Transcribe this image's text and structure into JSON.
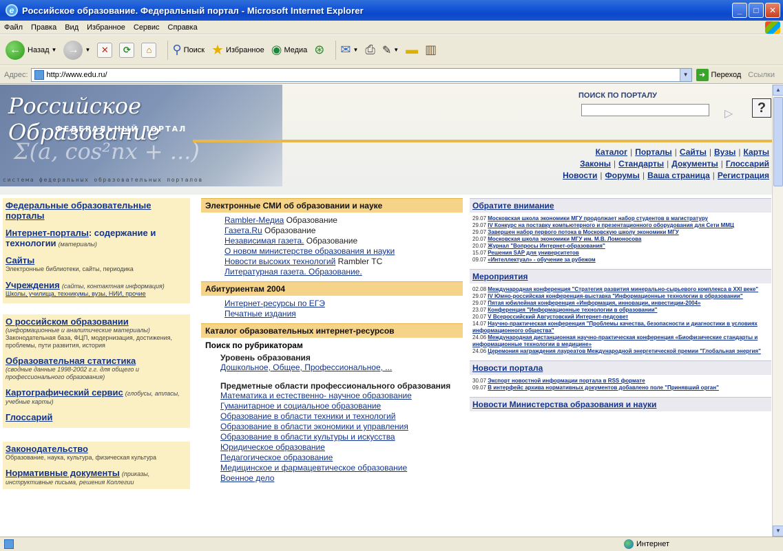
{
  "window": {
    "title": "Российское образование. Федеральный портал - Microsoft Internet Explorer"
  },
  "menu": [
    "Файл",
    "Правка",
    "Вид",
    "Избранное",
    "Сервис",
    "Справка"
  ],
  "toolbar": {
    "back": "Назад",
    "search": "Поиск",
    "favorites": "Избранное",
    "media": "Медиа"
  },
  "address": {
    "label": "Адрес:",
    "url": "http://www.edu.ru/",
    "go": "Переход",
    "links": "Ссылки"
  },
  "header": {
    "logo_title": "Российское Образование",
    "logo_sub": "ФЕДЕРАЛЬНЫЙ ПОРТАЛ",
    "formula": "Σ(a, cos²nx + ...)",
    "tagline": "система федеральных образовательных порталов",
    "search_title": "ПОИСК ПО ПОРТАЛУ",
    "help": "?"
  },
  "topnav": {
    "row1": [
      "Каталог",
      "Порталы",
      "Сайты",
      "Вузы",
      "Карты"
    ],
    "row2": [
      "Законы",
      "Стандарты",
      "Документы",
      "Глоссарий"
    ],
    "row3": [
      "Новости",
      "Форумы",
      "Ваша страница",
      "Регистрация"
    ]
  },
  "left": {
    "fed_portals": "Федеральные образовательные порталы",
    "inet_portals": "Интернет-порталы",
    "inet_portals_tail": ": содержание и технологии",
    "inet_portals_sub": "(материалы)",
    "sites": "Сайты",
    "sites_desc": "Электронные библиотеки, сайты, периодика",
    "institutions": "Учреждения",
    "institutions_sub": "(сайты, контактная информация)",
    "institutions_links": "Школы, училища, техникумы, вузы, НИИ, прочие",
    "ru_edu": "О российском образовании",
    "ru_edu_sub": "(информационные и аналитические материалы)",
    "ru_edu_desc": "Законодательная база, ФЦП, модернизация, достижения, проблемы, пути развития, история",
    "stats": "Образовательная статистика",
    "stats_sub": "(сводные данные 1998-2002 г.г. для общего и профессионального образования)",
    "cartography": "Картографический сервис",
    "cartography_sub": "(глобусы, атласы, учебные карты)",
    "glossary": "Глоссарий",
    "legislation": "Законодательство",
    "legislation_desc": "Образование, наука, культура, физическая культура",
    "normative": "Нормативные документы",
    "normative_sub": "(приказы, инструктивные письма, решения Коллегии"
  },
  "mid": {
    "smi_head": "Электронные СМИ об образовании и науке",
    "smi": [
      {
        "link": "Rambler-Медиа",
        "tail": " Образование"
      },
      {
        "link": "Газета.Ru",
        "tail": " Образование"
      },
      {
        "link": "Независимая газета.",
        "tail": " Образование"
      },
      {
        "link": "О новом министерстве образования и науки",
        "tail": ""
      },
      {
        "link": "Новости высоких технологий",
        "tail": " Rambler ТС"
      },
      {
        "link": "Литературная газета. Образование.",
        "tail": ""
      }
    ],
    "abit_head": "Абитуриентам 2004",
    "abit": [
      "Интернет-ресурсы по ЕГЭ",
      "Печатные издания"
    ],
    "catalog_head": "Каталог образовательных интернет-ресурсов",
    "rubricators": "Поиск по рубрикаторам",
    "level_head": "Уровень образования",
    "level_links": "Дошкольное, Общее, Профессиональное, ...",
    "subject_head": "Предметные области профессионального образования",
    "subjects": [
      "Математика и естественно- научное образование",
      "Гуманитарное и социальное образование",
      "Образование в области техники и технологий",
      "Образование в области экономики и управления",
      "Образование в области культуры и искусства",
      "Юридическое образование",
      "Педагогическое образование",
      "Медицинское и фармацевтическое образование",
      "Военное дело"
    ]
  },
  "right": {
    "attention_head": "Обратите внимание",
    "attention": [
      {
        "date": "29.07",
        "text": "Московская школа экономики МГУ продолжает набор студентов в магистратуру"
      },
      {
        "date": "29.07",
        "text": "IV Конкурс на поставку компьютерного и презентационного оборудования для Сети ММЦ"
      },
      {
        "date": "29.07",
        "text": "Завершен набор первого потока в Московскую школу экономики МГУ"
      },
      {
        "date": "20.07",
        "text": "Московская школа экономики МГУ им. М.В. Ломоносова"
      },
      {
        "date": "20.07",
        "text": "Журнал \"Вопросы Интернет-образования\""
      },
      {
        "date": "15.07",
        "text": "Решения SAP для университетов"
      },
      {
        "date": "09.07",
        "text": "«Интеллектуал» - обучение за рубежом"
      }
    ],
    "events_head": "Мероприятия",
    "events": [
      {
        "date": "02.08",
        "text": "Международная конференция \"Стратегия развития минерально-сырьевого комплекса в XXI веке\""
      },
      {
        "date": "29.07",
        "text": "IV Юмно-российская конференция-выставка \"Информационные технологии в образовании\""
      },
      {
        "date": "29.07",
        "text": "Пятая юбилейная конференция «Информация, инновации, инвестиции-2004»"
      },
      {
        "date": "23.07",
        "text": "Конференция \"Информационные технологии в образовании\""
      },
      {
        "date": "20.07",
        "text": "V Всероссийский Августовский Интернет-педсовет"
      },
      {
        "date": "14.07",
        "text": "Научно-практическая конференция \"Проблемы качества, безопасности и диагностики в условиях информационного общества\""
      },
      {
        "date": "24.06",
        "text": "Международная дистанционная научно-практическая конференция «Биофизические стандарты и информационные технологии в медицине»"
      },
      {
        "date": "24.06",
        "text": "Церемония награждения лауреатов Международной энергетической премии \"Глобальная энергия\""
      }
    ],
    "news_head": "Новости портала",
    "news": [
      {
        "date": "30.07",
        "text": "Экспорт новостной информации портала в RSS формате"
      },
      {
        "date": "09.07",
        "text": "В интерфейс архива нормативных документов добавлено поле \"Принявший орган\""
      }
    ],
    "ministry_head": "Новости Министерства образования и науки"
  },
  "status": {
    "zone": "Интернет"
  }
}
